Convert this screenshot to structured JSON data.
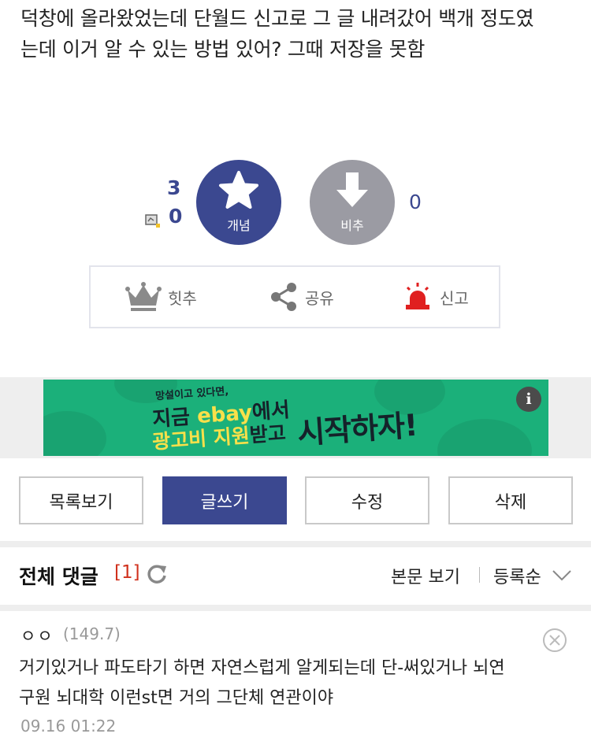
{
  "post": {
    "line1": "덕창에 올라왔었는데 단월드 신고로 그 글 내려갔어 백개 정도였",
    "line2": "는데 이거 알 수 있는 방법 있어? 그때 저장을 못함"
  },
  "votes": {
    "recommend_count": "3",
    "fixed_count": "0",
    "up_label": "개념",
    "down_label": "비추",
    "down_count": "0"
  },
  "actions": {
    "hit": "힛추",
    "share": "공유",
    "report": "신고"
  },
  "banner": {
    "line1": "망설이고 있다면,",
    "line2_pre": "지금 ",
    "line2_hl": "ebay",
    "line2_post": "에서",
    "line3_hl": "광고비 지원",
    "line3_post": "받고",
    "line4": "시작하자!",
    "info": "i"
  },
  "buttons": {
    "list": "목록보기",
    "write": "글쓰기",
    "edit": "수정",
    "delete": "삭제"
  },
  "comments_header": {
    "title": "전체 댓글",
    "count": "[1]",
    "view_body": "본문 보기",
    "sort": "등록순"
  },
  "comments": [
    {
      "author": "ㅇㅇ",
      "ip": "(149.7)",
      "line1": "거기있거나 파도타기 하면 자연스럽게 알게되는데 단-써있거나 뇌연",
      "line2": "구원 뇌대학 이런st면 거의 그단체 연관이야",
      "date": "09.16 01:22"
    }
  ],
  "colors": {
    "brand": "#3b4890",
    "downvote": "#9b9ba3",
    "banner_bg": "#1bb07a",
    "comment_count": "#d0311d"
  }
}
